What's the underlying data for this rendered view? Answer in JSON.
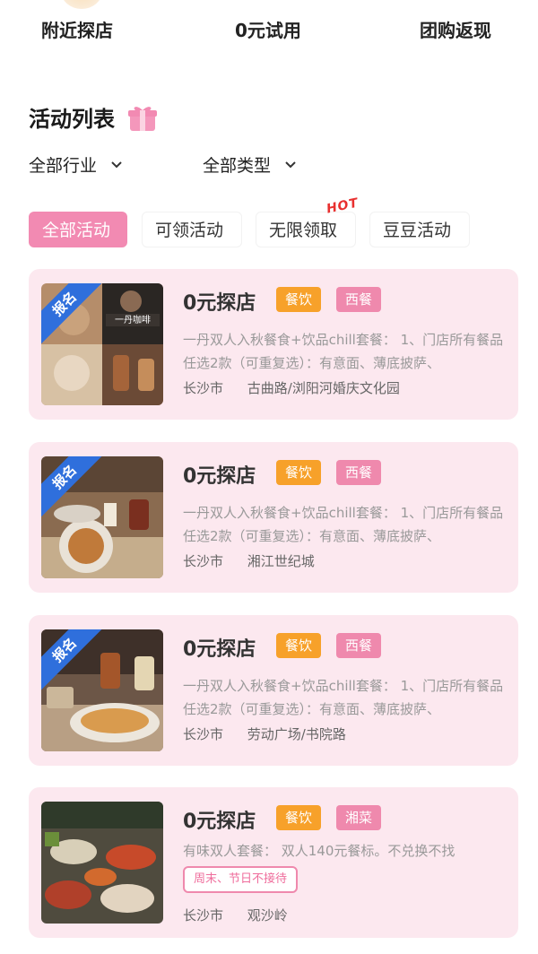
{
  "topnav": {
    "items": [
      "附近探店",
      "0元试用",
      "团购返现"
    ]
  },
  "section": {
    "title": "活动列表",
    "icon": "gift-icon"
  },
  "filters": {
    "industry": "全部行业",
    "type": "全部类型"
  },
  "tabs": [
    {
      "label": "全部活动",
      "active": true
    },
    {
      "label": "可领活动",
      "active": false
    },
    {
      "label": "无限领取",
      "active": false
    },
    {
      "label": "豆豆活动",
      "active": false
    }
  ],
  "hot_label": "HOT",
  "colors": {
    "accent": "#f28ab2",
    "card_bg": "#fce8ef",
    "tag_category": "#f7a12a",
    "tag_sub": "#ef89ad",
    "ribbon": "#2f6fdc",
    "hot": "#e8302f"
  },
  "cards": [
    {
      "ribbon": "报名",
      "title": "0元探店",
      "tag_category": "餐饮",
      "tag_sub": "西餐",
      "desc": "一丹双人入秋餐食+饮品chill套餐：  1、门店所有餐品任选2款（可重复选）：有意面、薄底披萨、",
      "city": "长沙市",
      "address": "古曲路/浏阳河婚庆文化园",
      "thumb_text": "一丹咖啡"
    },
    {
      "ribbon": "报名",
      "title": "0元探店",
      "tag_category": "餐饮",
      "tag_sub": "西餐",
      "desc": "一丹双人入秋餐食+饮品chill套餐：  1、门店所有餐品任选2款（可重复选）：有意面、薄底披萨、",
      "city": "长沙市",
      "address": "湘江世纪城"
    },
    {
      "ribbon": "报名",
      "title": "0元探店",
      "tag_category": "餐饮",
      "tag_sub": "西餐",
      "desc": "一丹双人入秋餐食+饮品chill套餐：  1、门店所有餐品任选2款（可重复选）：有意面、薄底披萨、",
      "city": "长沙市",
      "address": "劳动广场/书院路"
    },
    {
      "title": "0元探店",
      "tag_category": "餐饮",
      "tag_sub": "湘菜",
      "desc": "有味双人套餐：  双人140元餐标。不兑换不找",
      "notice": "周末、节日不接待",
      "city": "长沙市",
      "address": "观沙岭"
    }
  ]
}
